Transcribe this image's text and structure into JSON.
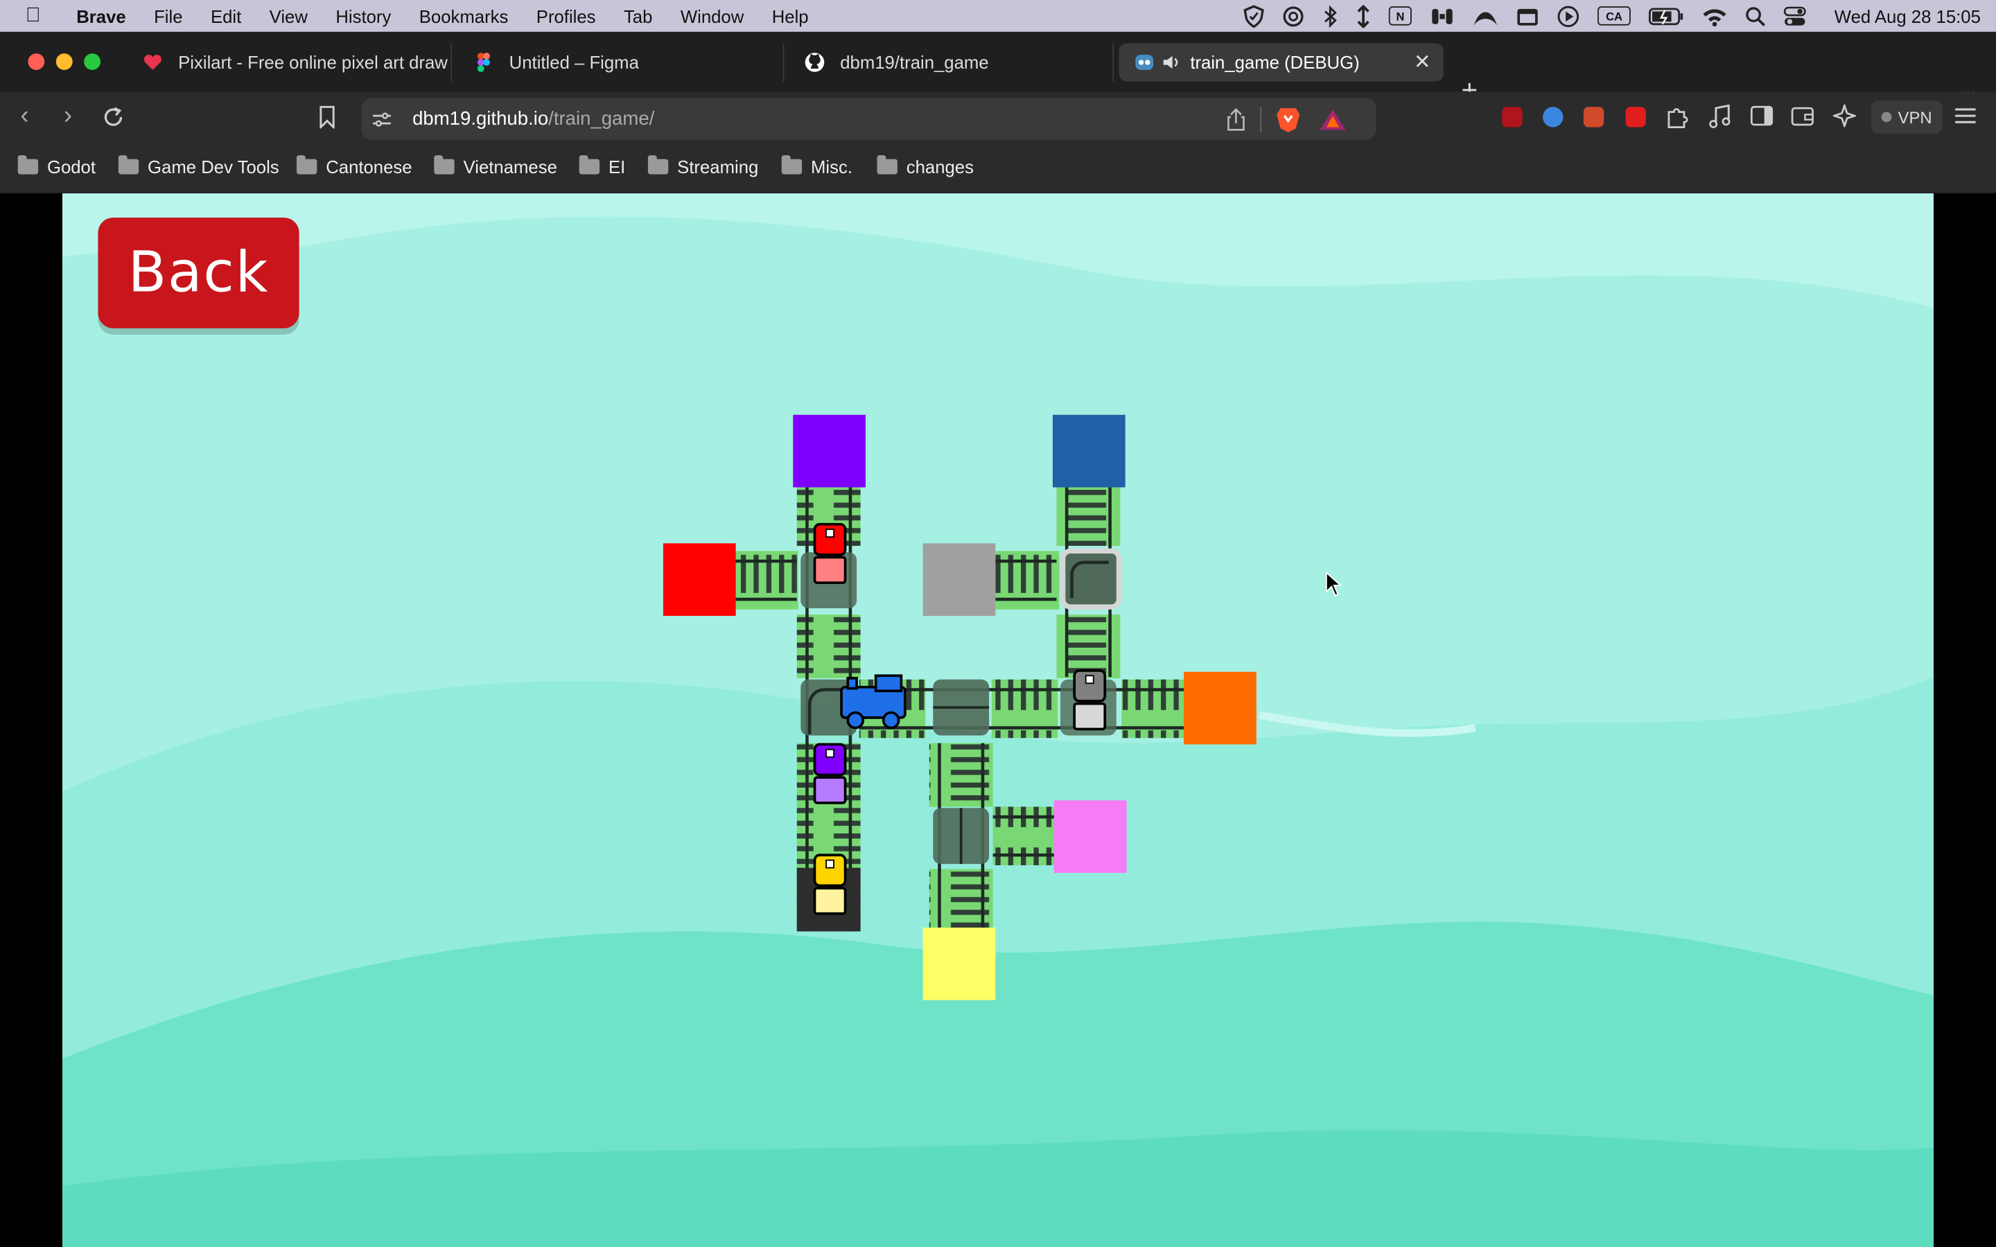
{
  "menubar": {
    "app_name": "Brave",
    "menus": [
      "File",
      "Edit",
      "View",
      "History",
      "Bookmarks",
      "Profiles",
      "Tab",
      "Window",
      "Help"
    ],
    "status_icons": [
      "shield-icon",
      "openai-icon",
      "bluetooth-icon",
      "arrows-updown-icon",
      "notion-icon",
      "airpods-icon",
      "arc-icon",
      "calendar-icon",
      "play-icon",
      "keyboard-input-icon",
      "battery-icon",
      "wifi-icon",
      "spotlight-icon",
      "control-center-icon"
    ],
    "input_source": "CA",
    "notion_letter": "N",
    "clock": "Wed Aug 28  15:05"
  },
  "tabs": [
    {
      "title": "Pixilart - Free online pixel art draw",
      "icon": "pixilart-heart-icon",
      "color": "#e8344e"
    },
    {
      "title": "Untitled – Figma",
      "icon": "figma-icon",
      "color": "#f24e1e"
    },
    {
      "title": "dbm19/train_game",
      "icon": "github-icon",
      "color": "#ffffff"
    },
    {
      "title": "train_game (DEBUG)",
      "icon": "godot-icon",
      "color": "#478cbf",
      "active": true
    }
  ],
  "toolbar": {
    "url_host": "dbm19.github.io",
    "url_path": "/train_game/",
    "vpn_label": "VPN"
  },
  "bookmarks": [
    "Godot",
    "Game Dev Tools",
    "Cantonese",
    "Vietnamese",
    "EI",
    "Streaming",
    "Misc.",
    "changes"
  ],
  "game": {
    "back_label": "Back",
    "colors": {
      "purple": "#8000ff",
      "blue": "#2060a8",
      "red": "#ff0000",
      "grey": "#a0a0a0",
      "orange": "#ff6a00",
      "pink": "#f57cf5",
      "yellow": "#ffff66",
      "grass": "#6fcf6a",
      "engine": "#1e6fe8"
    },
    "stations": [
      "purple",
      "blue",
      "red",
      "grey",
      "orange",
      "pink",
      "yellow"
    ],
    "trains": [
      "red",
      "purple",
      "yellow",
      "grey"
    ]
  }
}
